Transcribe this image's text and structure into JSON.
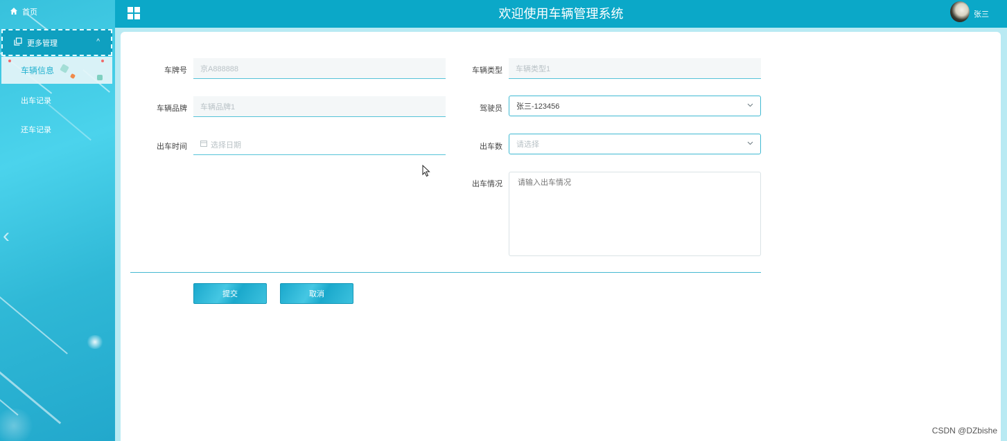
{
  "header": {
    "title": "欢迎使用车辆管理系统",
    "user_name": "张三"
  },
  "sidebar": {
    "home_label": "首页",
    "group_label": "更多管理",
    "items": [
      {
        "label": "车辆信息",
        "active": true
      },
      {
        "label": "出车记录",
        "active": false
      },
      {
        "label": "还车记录",
        "active": false
      }
    ]
  },
  "form": {
    "plate": {
      "label": "车牌号",
      "placeholder": "京A888888"
    },
    "vehicle_type": {
      "label": "车辆类型",
      "placeholder": "车辆类型1"
    },
    "brand": {
      "label": "车辆品牌",
      "placeholder": "车辆品牌1"
    },
    "driver": {
      "label": "驾驶员",
      "value": "张三-123456"
    },
    "depart_time": {
      "label": "出车时间",
      "placeholder": "选择日期"
    },
    "depart_count": {
      "label": "出车数",
      "placeholder": "请选择"
    },
    "depart_status": {
      "label": "出车情况",
      "placeholder": "请输入出车情况"
    }
  },
  "buttons": {
    "submit": "提交",
    "cancel": "取消"
  },
  "watermark": "CSDN @DZbishe",
  "colors": {
    "header_bg": "#0ba8c8",
    "accent": "#3fb9d2",
    "sidebar_active_text": "#22b1cf"
  }
}
